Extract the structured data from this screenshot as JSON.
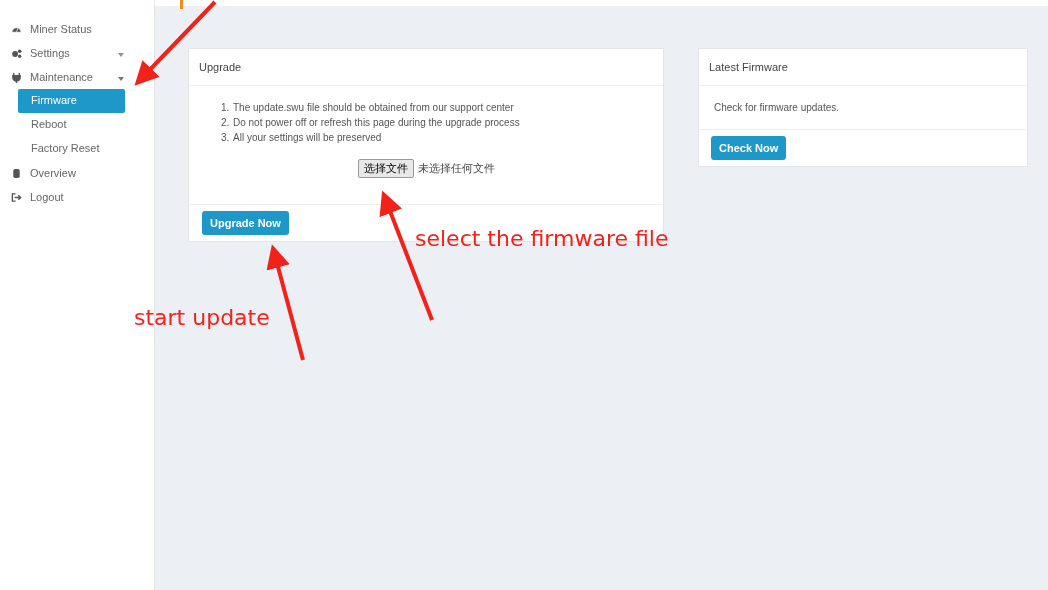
{
  "sidebar": {
    "items": [
      {
        "label": "Miner Status",
        "selected": false
      },
      {
        "label": "Settings",
        "selected": false,
        "expanded": false
      },
      {
        "label": "Maintenance",
        "selected": false,
        "expanded": true,
        "children": [
          {
            "label": "Firmware",
            "selected": true
          },
          {
            "label": "Reboot",
            "selected": false
          },
          {
            "label": "Factory Reset",
            "selected": false
          }
        ]
      },
      {
        "label": "Overview",
        "selected": false
      },
      {
        "label": "Logout",
        "selected": false
      }
    ]
  },
  "upgrade_card": {
    "title": "Upgrade",
    "steps": [
      {
        "number": "1.",
        "text": "The update.swu file should be obtained from our support center"
      },
      {
        "number": "2.",
        "text": "Do not power off or refresh this page during the upgrade process"
      },
      {
        "number": "3.",
        "text": "All your settings will be preserved"
      }
    ],
    "file_button": "选择文件",
    "file_status": "未选择任何文件",
    "button": "Upgrade Now"
  },
  "latest_card": {
    "title": "Latest Firmware",
    "text": "Check for firmware updates.",
    "button": "Check Now"
  },
  "annotations": [
    {
      "text": "select the firmware file"
    },
    {
      "text": "start update"
    }
  ]
}
